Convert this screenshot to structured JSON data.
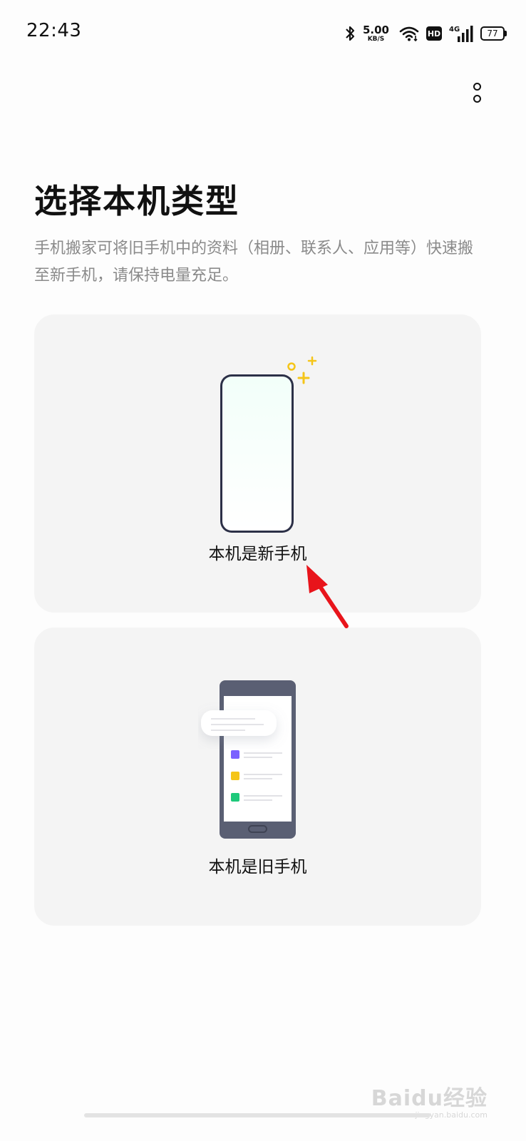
{
  "status_bar": {
    "time": "22:43",
    "net_speed_value": "5.00",
    "net_speed_unit": "KB/S",
    "hd_label": "HD",
    "network_type": "4G",
    "battery": "77"
  },
  "header": {
    "title": "选择本机类型",
    "description": "手机搬家可将旧手机中的资料（相册、联系人、应用等）快速搬至新手机，请保持电量充足。"
  },
  "options": [
    {
      "label": "本机是新手机",
      "icon": "new-phone-illustration"
    },
    {
      "label": "本机是旧手机",
      "icon": "old-phone-illustration"
    }
  ],
  "watermark": {
    "main": "Baidu经验",
    "sub": "jingyan.baidu.com"
  },
  "colors": {
    "card_bg": "#f4f4f4",
    "accent_yellow": "#f5c518",
    "annotation_red": "#e8141b",
    "old_phone_frame": "#5a5f73",
    "list_purple": "#7b61ff",
    "list_yellow": "#f5c518",
    "list_green": "#1ec97b"
  }
}
